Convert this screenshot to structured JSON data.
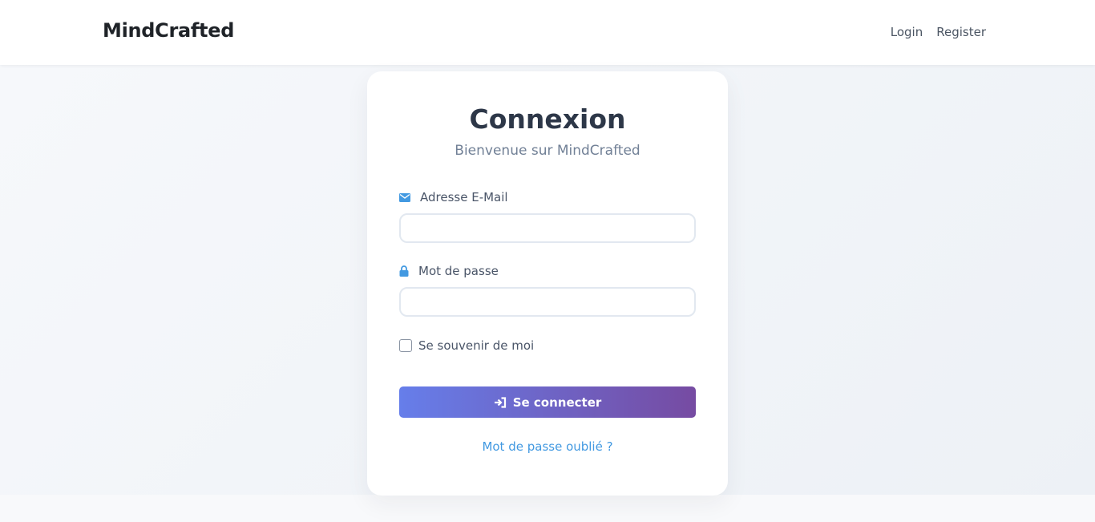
{
  "nav": {
    "brand": "MindCrafted",
    "links": [
      {
        "label": "Login"
      },
      {
        "label": "Register"
      }
    ]
  },
  "card": {
    "title": "Connexion",
    "subtitle": "Bienvenue sur MindCrafted",
    "email": {
      "label": "Adresse E-Mail",
      "icon": "envelope-icon",
      "value": "",
      "placeholder": ""
    },
    "password": {
      "label": "Mot de passe",
      "icon": "lock-icon",
      "value": "",
      "placeholder": ""
    },
    "remember": {
      "label": "Se souvenir de moi",
      "checked": false
    },
    "submit": {
      "label": "Se connecter",
      "icon": "sign-in-icon"
    },
    "forgot": "Mot de passe oublié ?"
  },
  "colors": {
    "accent": "#4299e1",
    "button_gradient_start": "#667eea",
    "button_gradient_end": "#764ba2",
    "title": "#2d3748",
    "subtitle": "#718096"
  }
}
